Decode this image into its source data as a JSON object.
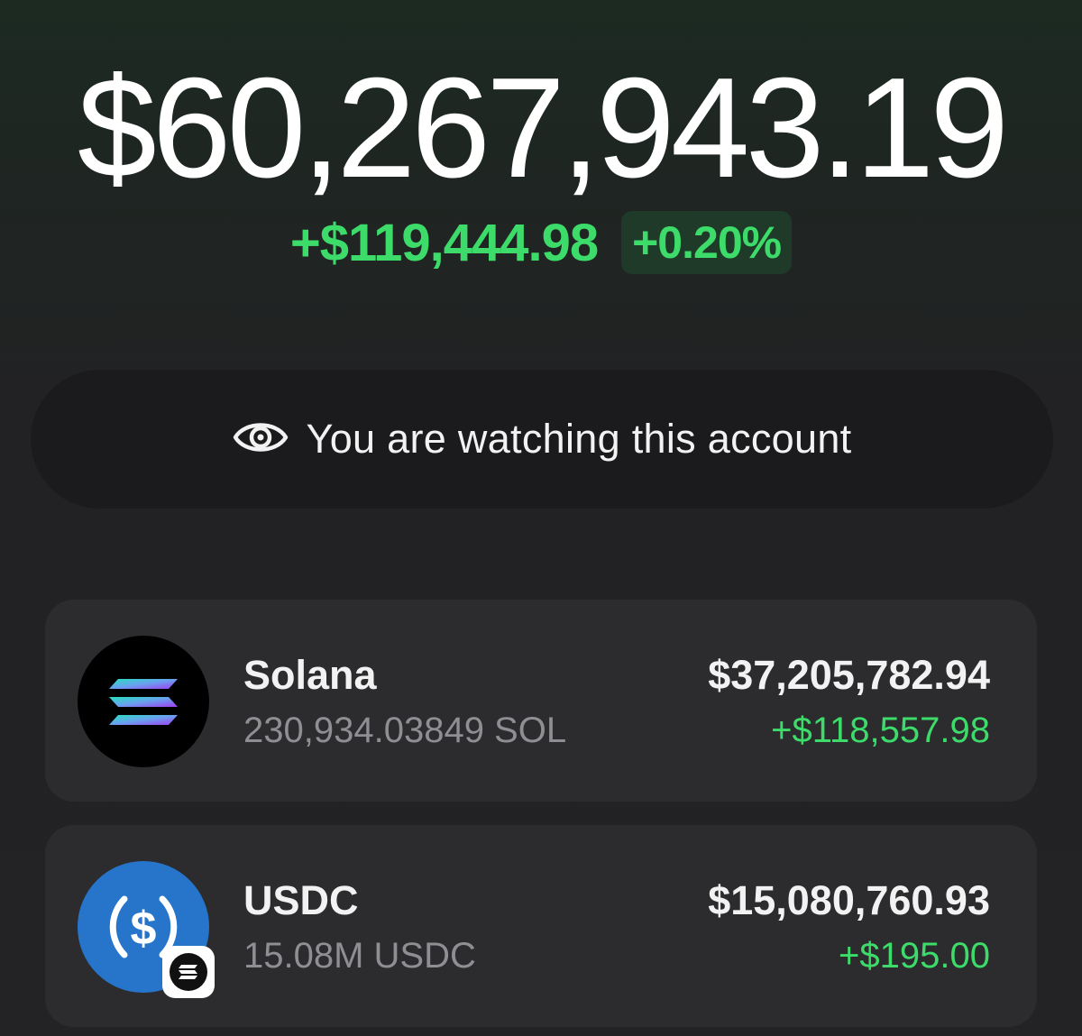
{
  "portfolio": {
    "total_balance": "$60,267,943.19",
    "change_amount": "+$119,444.98",
    "change_percent": "+0.20%"
  },
  "watch_banner": {
    "icon": "eye-icon",
    "text": "You are watching this account"
  },
  "assets": [
    {
      "icon": "solana-logo",
      "name": "Solana",
      "amount": "230,934.03849 SOL",
      "value": "$37,205,782.94",
      "change": "+$118,557.98"
    },
    {
      "icon": "usdc-logo",
      "badge_icon": "solana-network-badge",
      "name": "USDC",
      "amount": "15.08M USDC",
      "value": "$15,080,760.93",
      "change": "+$195.00"
    }
  ],
  "colors": {
    "positive": "#3ddc6a",
    "positive_bg": "#1f3a28",
    "card_bg": "#2c2c2f",
    "usdc_blue": "#2775ca"
  }
}
